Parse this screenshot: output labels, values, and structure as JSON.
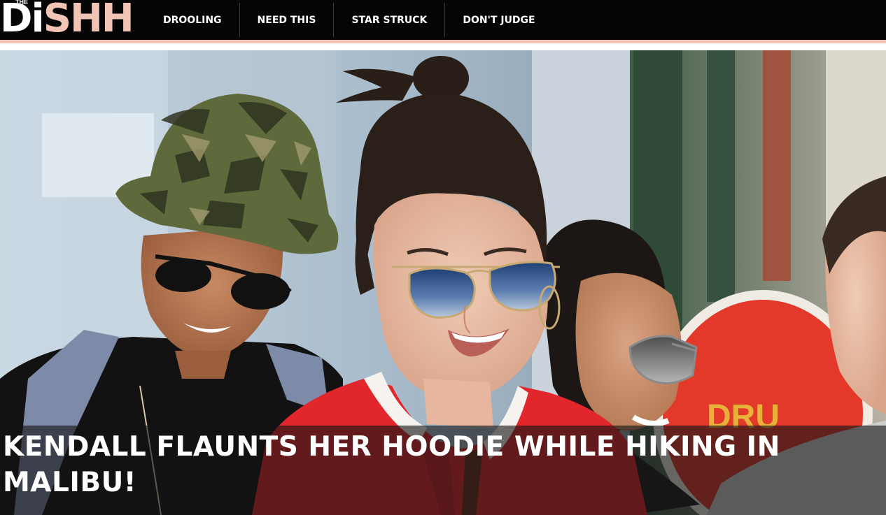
{
  "site": {
    "logo_prefix": "Di",
    "logo_suffix": "SHH",
    "logo_small": "THE"
  },
  "nav": {
    "items": [
      {
        "label": "DROOLING"
      },
      {
        "label": "NEED THIS"
      },
      {
        "label": "STAR STRUCK"
      },
      {
        "label": "DON'T JUDGE"
      }
    ]
  },
  "hero": {
    "headline": "KENDALL FLAUNTS HER HOODIE WHILE HIKING IN MALIBU!"
  },
  "colors": {
    "nav_background": "#050505",
    "accent": "#f2c4b4",
    "jacket_red": "#e1262c"
  }
}
